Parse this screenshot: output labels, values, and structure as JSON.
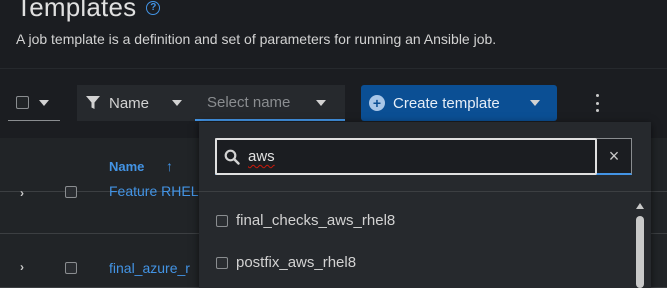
{
  "header": {
    "title": "Templates",
    "help_icon": "?",
    "subtitle": "A job template is a definition and set of parameters for running an Ansible job."
  },
  "toolbar": {
    "filter_attribute": "Name",
    "filter_placeholder": "Select name",
    "create_label": "Create template"
  },
  "table": {
    "column_name": "Name",
    "sort_icon": "↑",
    "rows": [
      {
        "toggle": "›",
        "name": "Feature RHEL"
      },
      {
        "toggle": "›",
        "name": "final_azure_r"
      }
    ]
  },
  "menu": {
    "search_value": "aws",
    "clear_icon": "×",
    "options": [
      {
        "label": "final_checks_aws_rhel8"
      },
      {
        "label": "postfix_aws_rhel8"
      }
    ]
  },
  "colors": {
    "accent": "#4394e5",
    "primary_button": "#0b4f94",
    "background": "#1b1d21"
  },
  "icons": {
    "filter": "filter-icon",
    "search": "search-icon",
    "add": "plus-circle-icon",
    "kebab": "kebab-icon"
  }
}
